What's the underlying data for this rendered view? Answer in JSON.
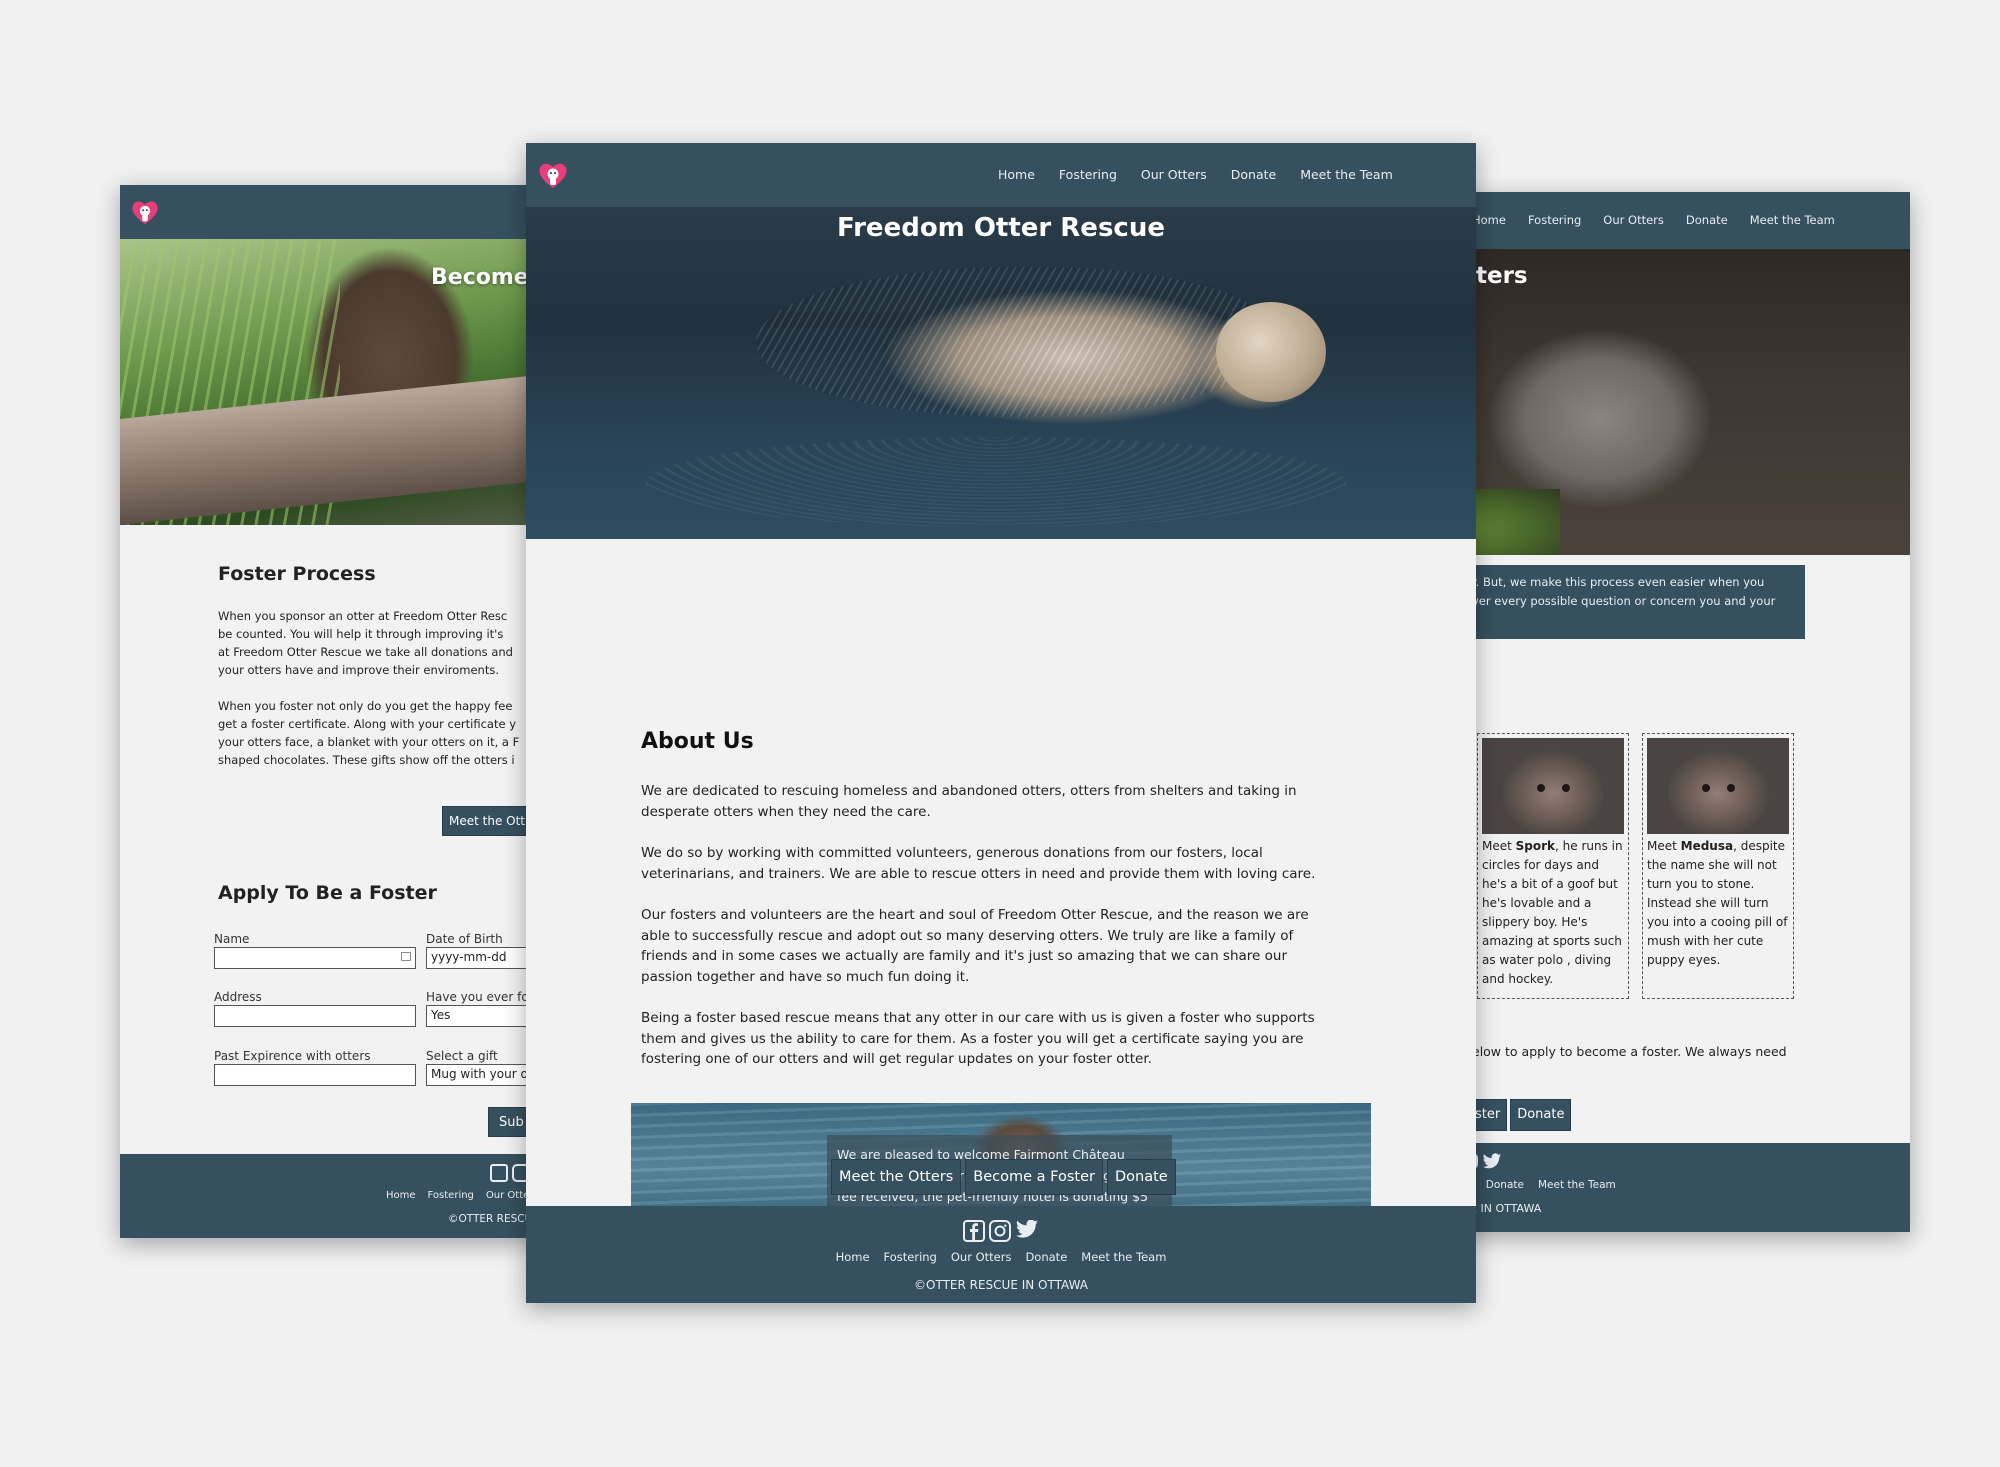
{
  "brand": {
    "pink": "#e83e7c",
    "navy": "#36505f",
    "page_bg": "#f2f2f2"
  },
  "icons": {
    "logo": "heart-otter-logo",
    "facebook": "facebook-icon",
    "instagram": "instagram-icon",
    "twitter": "twitter-icon"
  },
  "left_page": {
    "hero_title": "Become",
    "section_title": "Foster Process",
    "paragraphs": [
      "When you sponsor an otter at Freedom Otter Resc\nbe counted. You will help it through improving it's\nat Freedom Otter Rescue we take all donations and\nyour otters have and improve their enviroments.",
      "When you foster not only do you get the happy fee\nget a foster certificate. Along with your certificate y\nyour otters face, a blanket with your otters on it, a F\nshaped chocolates. These gifts show off the otters i"
    ],
    "meet_button": "Meet the Ott",
    "apply_title": "Apply To Be a Foster",
    "form": {
      "name_label": "Name",
      "dob_label": "Date of Birth",
      "dob_value": "yyyy-mm-dd",
      "address_label": "Address",
      "have_you_label": "Have you ever fo",
      "have_you_value": "Yes",
      "experience_label": "Past Expirence with otters",
      "gift_label": "Select a gift",
      "gift_value": "Mug with your o"
    },
    "submit_button": "Sub",
    "footer_links": [
      "Home",
      "Fostering",
      "Our Otte"
    ],
    "copyright": "©OTTER RESCU"
  },
  "right_page": {
    "nav": [
      "Home",
      "Fostering",
      "Our Otters",
      "Donate",
      "Meet the Team"
    ],
    "hero_title": "tters",
    "callout": "r. But, we make this process even easier when you\nver every possible question or concern you and your",
    "otters": [
      {
        "pre": "Meet ",
        "name": "Spork",
        "bio": ", he runs in circles for days and he's a bit of a goof but he's lovable and a slippery boy. He's amazing at sports such as water polo , diving and hockey."
      },
      {
        "pre": "Meet ",
        "name": "Medusa",
        "bio": ", despite the name she will not turn you to stone. Instead she will turn you into a cooing pill of mush with her cute puppy eyes."
      }
    ],
    "apply_text": "elow to apply to become a foster. We always need",
    "buttons": [
      "ster",
      "Donate"
    ],
    "footer_links": [
      "rs",
      "Donate",
      "Meet the Team"
    ],
    "copyright": "UE IN OTTAWA"
  },
  "center_page": {
    "nav": [
      "Home",
      "Fostering",
      "Our Otters",
      "Donate",
      "Meet the Team"
    ],
    "hero_title": "Freedom Otter Rescue",
    "about_title": "About Us",
    "paragraphs": [
      "We are dedicated to rescuing homeless and abandoned otters, otters from shelters and taking in\ndesperate otters when they need the care.",
      "We do so by working with committed volunteers, generous donations from our fosters, local\nveterinarians, and trainers. We are able to rescue otters in need and provide them with loving care.",
      "Our fosters and volunteers are the heart and soul of Freedom Otter Rescue, and the reason we are\nable to successfully rescue and adopt out so many deserving otters. We truly are like a family of\nfriends and in some cases we actually are family and it's just so amazing that we can share our\npassion together and have so much fun doing it.",
      "Being a foster based rescue means that any otter in our care with us is given a foster who supports\nthem and gives us the ability to care for them. As a foster you will get a certificate saying you are\nfostering one of our otters and will get regular updates on your foster otter."
    ],
    "banner_text": "We are pleased to welcome Fairmont Château\nLaurier as a sponsor for 2018. For every nightly pet\nfee received, the pet-friendly hotel is donating $5 to\nsupport FDR initiatives.",
    "buttons": [
      "Meet the Otters",
      "Become a Foster",
      "Donate"
    ],
    "footer_links": [
      "Home",
      "Fostering",
      "Our Otters",
      "Donate",
      "Meet the Team"
    ],
    "copyright": "©OTTER RESCUE IN OTTAWA"
  }
}
